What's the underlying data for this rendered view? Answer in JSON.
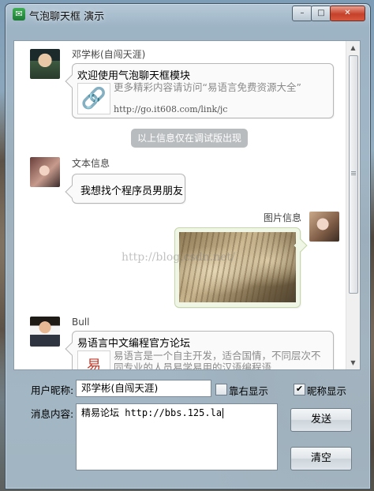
{
  "window": {
    "title": "气泡聊天框 演示",
    "controls": {
      "close": "✕",
      "minimize": "–",
      "maximize": "□"
    }
  },
  "messages": [
    {
      "sender": "邓学彬(自闯天涯)",
      "title": "欢迎使用气泡聊天框模块",
      "link_desc": "更多精彩内容请访问“易语言免费资源大全”",
      "link_url": "http://go.it608.com/link/jc"
    },
    {
      "sender": "文本信息",
      "text": "我想找个程序员男朋友"
    },
    {
      "sender": "图片信息"
    },
    {
      "sender": "Bull",
      "title": "易语言中文编程官方论坛",
      "desc": "易语言是一个自主开发，适合国情，不同层次不同专业的人员易学易用的汉语编程语"
    }
  ],
  "system_note": "以上信息仅在调试版出现",
  "watermark": "http://blog.csdn.net/",
  "form": {
    "nickname_label": "用户昵称:",
    "nickname_value": "邓学彬(自闯天涯)",
    "align_right_label": "靠右显示",
    "align_right_checked": false,
    "show_nick_label": "昵称显示",
    "show_nick_checked": true,
    "message_label": "消息内容:",
    "message_value": "精易论坛 http://bbs.125.la",
    "send_label": "发送",
    "clear_label": "清空"
  },
  "icons": [
    "app-icon",
    "link-icon",
    "forum-logo-icon",
    "scroll-up-arrow",
    "scroll-down-arrow",
    "check-icon"
  ]
}
